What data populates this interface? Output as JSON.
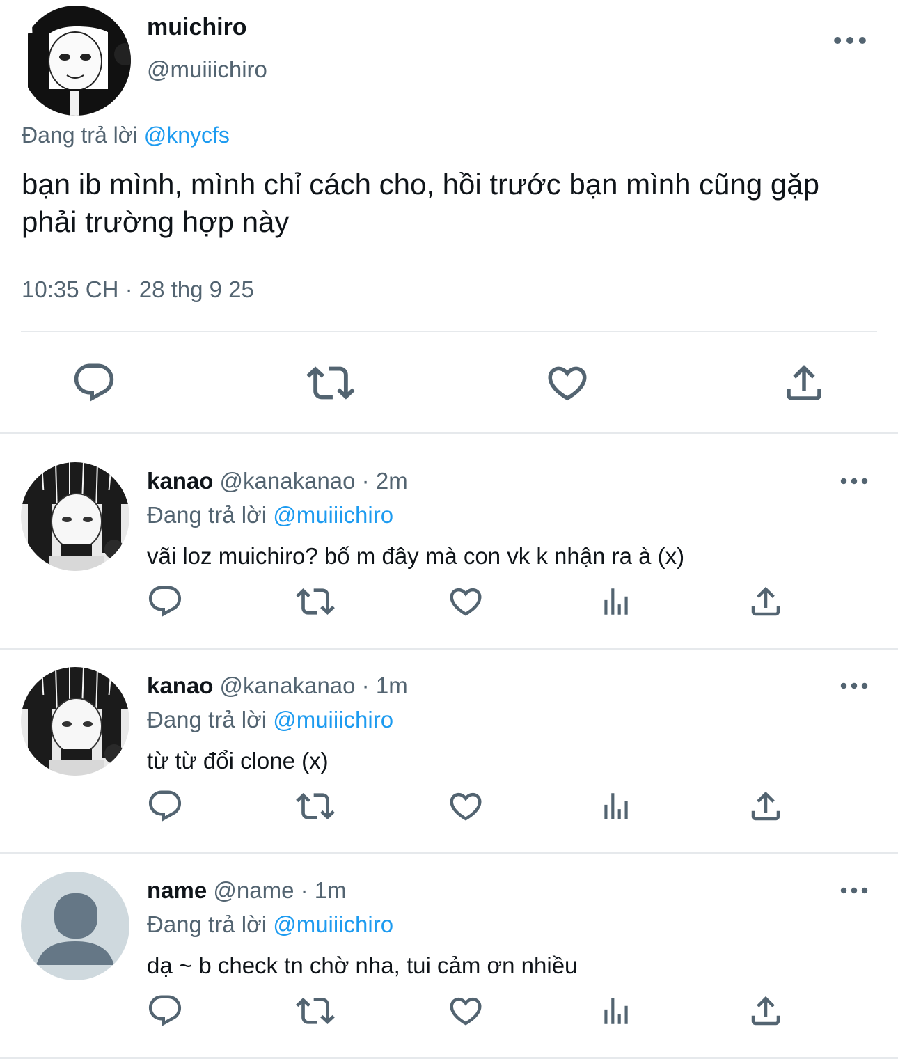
{
  "colors": {
    "text": "#0f1419",
    "secondary": "#536471",
    "mention": "#1d9bf0",
    "divider": "#e6e9ec",
    "icon": "#536471"
  },
  "main_tweet": {
    "name": "muichiro",
    "handle": "@muiiichiro",
    "replying_prefix": "Đang trả lời",
    "replying_to": "@knycfs",
    "text": "bạn ib mình, mình chỉ cách cho, hồi trước bạn mình cũng gặp phải trường hợp này",
    "timestamp": "10:35 CH · 28 thg 9 25",
    "actions": [
      "reply-icon",
      "retweet-icon",
      "like-icon",
      "share-icon"
    ]
  },
  "replies": [
    {
      "name": "kanao",
      "meta": "@kanakanao · 2m",
      "replying_prefix": "Đang trả lời",
      "replying_to": "@muiiichiro",
      "text": "vãi loz muichiro? bố m đây mà con vk k nhận ra à (x)",
      "avatar": "anime-avatar"
    },
    {
      "name": "kanao",
      "meta": "@kanakanao · 1m",
      "replying_prefix": "Đang trả lời",
      "replying_to": "@muiiichiro",
      "text": "từ từ đổi clone (x)",
      "avatar": "anime-avatar"
    },
    {
      "name": "name",
      "meta": "@name · 1m",
      "replying_prefix": "Đang trả lời",
      "replying_to": "@muiiichiro",
      "text": "dạ ~ b check tn chờ nha, tui cảm ơn nhiều",
      "avatar": "default-avatar"
    }
  ],
  "reply_actions": [
    "reply-icon",
    "retweet-icon",
    "like-icon",
    "views-icon",
    "share-icon"
  ]
}
